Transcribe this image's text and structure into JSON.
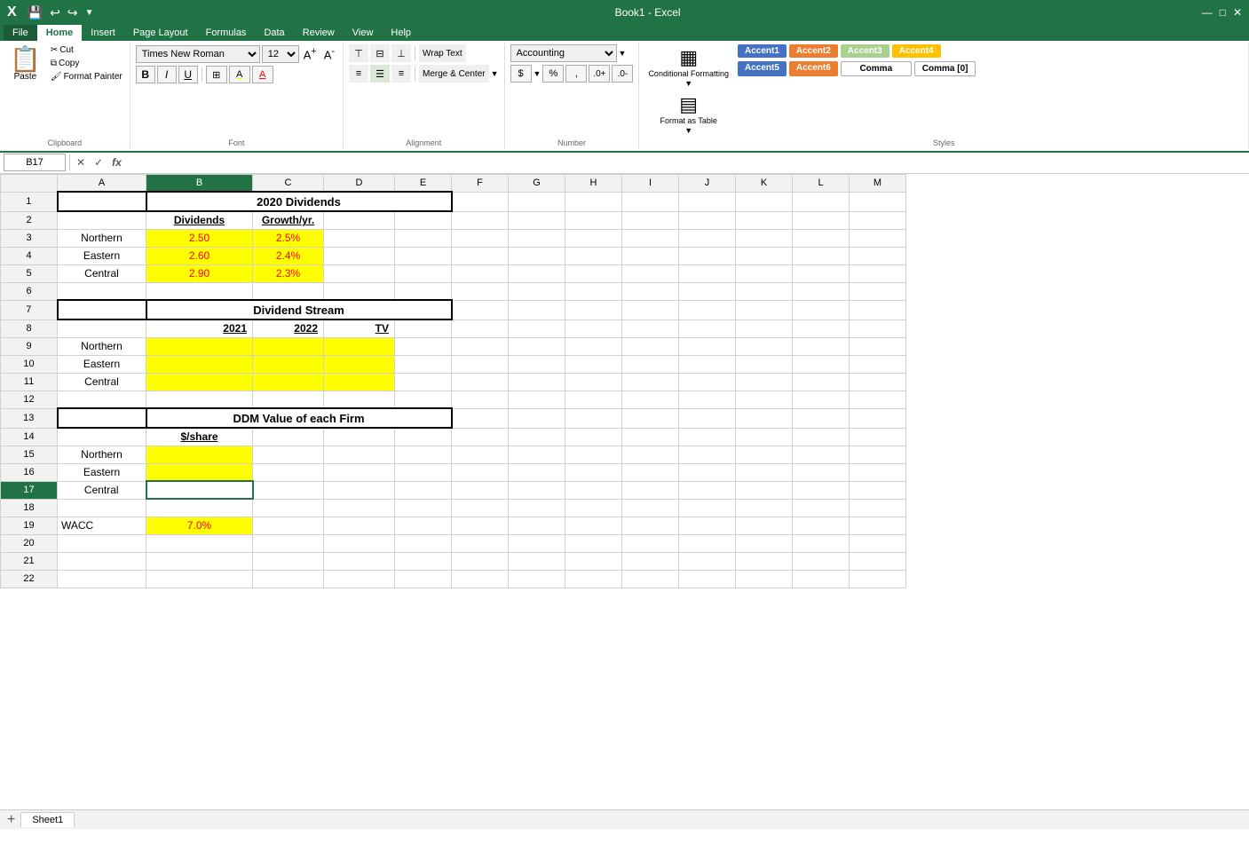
{
  "topBar": {
    "icons": [
      "💾",
      "↩",
      "↪",
      "▼"
    ]
  },
  "ribbon": {
    "tabs": [
      "File",
      "Home",
      "Insert",
      "Page Layout",
      "Formulas",
      "Data",
      "Review",
      "View",
      "Help"
    ],
    "activeTab": "Home",
    "clipboard": {
      "label": "Clipboard",
      "paste": "Paste",
      "cut": "Cut",
      "copy": "Copy",
      "formatPainter": "Format Painter"
    },
    "font": {
      "label": "Font",
      "fontName": "Times New Roman",
      "fontSize": "12",
      "boldLabel": "B",
      "italicLabel": "I",
      "underlineLabel": "U",
      "increaseFontLabel": "A↑",
      "decreaseFontLabel": "A↓"
    },
    "alignment": {
      "label": "Alignment",
      "wrapText": "Wrap Text",
      "mergeCenter": "Merge & Center"
    },
    "number": {
      "label": "Number",
      "format": "Accounting",
      "dollar": "$",
      "percent": "%",
      "comma": ","
    },
    "styles": {
      "label": "Styles",
      "conditionalFormatting": "Conditional Formatting",
      "formatAsTable": "Format as Table",
      "accent1": "Accent1",
      "accent2": "Accent2",
      "accent3": "Accent3",
      "accent4": "Accent4",
      "accent5": "Accent5",
      "accent6": "Accent6",
      "comma": "Comma",
      "comma0": "Comma [0]"
    }
  },
  "formulaBar": {
    "nameBox": "B17",
    "cancelLabel": "✕",
    "confirmLabel": "✓",
    "functionLabel": "fx",
    "formula": ""
  },
  "columns": [
    "",
    "A",
    "B",
    "C",
    "D",
    "E",
    "F",
    "G",
    "H",
    "I",
    "J",
    "K",
    "L",
    "M"
  ],
  "rows": {
    "1": {
      "A": "",
      "B": "2020 Dividends",
      "merged": true
    },
    "2": {
      "A": "",
      "B": "Dividends",
      "C": "Growth/yr."
    },
    "3": {
      "A": "Northern",
      "B": "2.50",
      "C": "2.5%",
      "yellowB": true,
      "yellowC": true,
      "redB": true,
      "redC": true
    },
    "4": {
      "A": "Eastern",
      "B": "2.60",
      "C": "2.4%",
      "yellowB": true,
      "yellowC": true,
      "redB": true,
      "redC": true
    },
    "5": {
      "A": "Central",
      "B": "2.90",
      "C": "2.3%",
      "yellowB": true,
      "yellowC": true,
      "redB": true,
      "redC": true
    },
    "6": {
      "A": "",
      "B": "",
      "C": ""
    },
    "7": {
      "A": "",
      "B": "Dividend Stream",
      "merged": true
    },
    "8": {
      "A": "",
      "B": "2021",
      "C": "2022",
      "D": "TV"
    },
    "9": {
      "A": "Northern",
      "B": "",
      "C": "",
      "D": "",
      "yellowBCD": true
    },
    "10": {
      "A": "Eastern",
      "B": "",
      "C": "",
      "D": "",
      "yellowBCD": true
    },
    "11": {
      "A": "Central",
      "B": "",
      "C": "",
      "D": "",
      "yellowBCD": true
    },
    "12": {
      "A": "",
      "B": ""
    },
    "13": {
      "A": "",
      "B": "DDM Value of each Firm",
      "merged": true
    },
    "14": {
      "A": "",
      "B": "$/share"
    },
    "15": {
      "A": "Northern",
      "B": "",
      "yellowB": true
    },
    "16": {
      "A": "Eastern",
      "B": "",
      "yellowB": true
    },
    "17": {
      "A": "Central",
      "B": "",
      "activeB": true
    },
    "18": {
      "A": "",
      "B": ""
    },
    "19": {
      "A": "WACC",
      "B": "7.0%",
      "yellowB": true,
      "redB": true
    },
    "20": {
      "A": "",
      "B": ""
    },
    "21": {
      "A": "",
      "B": ""
    },
    "22": {
      "A": "",
      "B": ""
    }
  }
}
